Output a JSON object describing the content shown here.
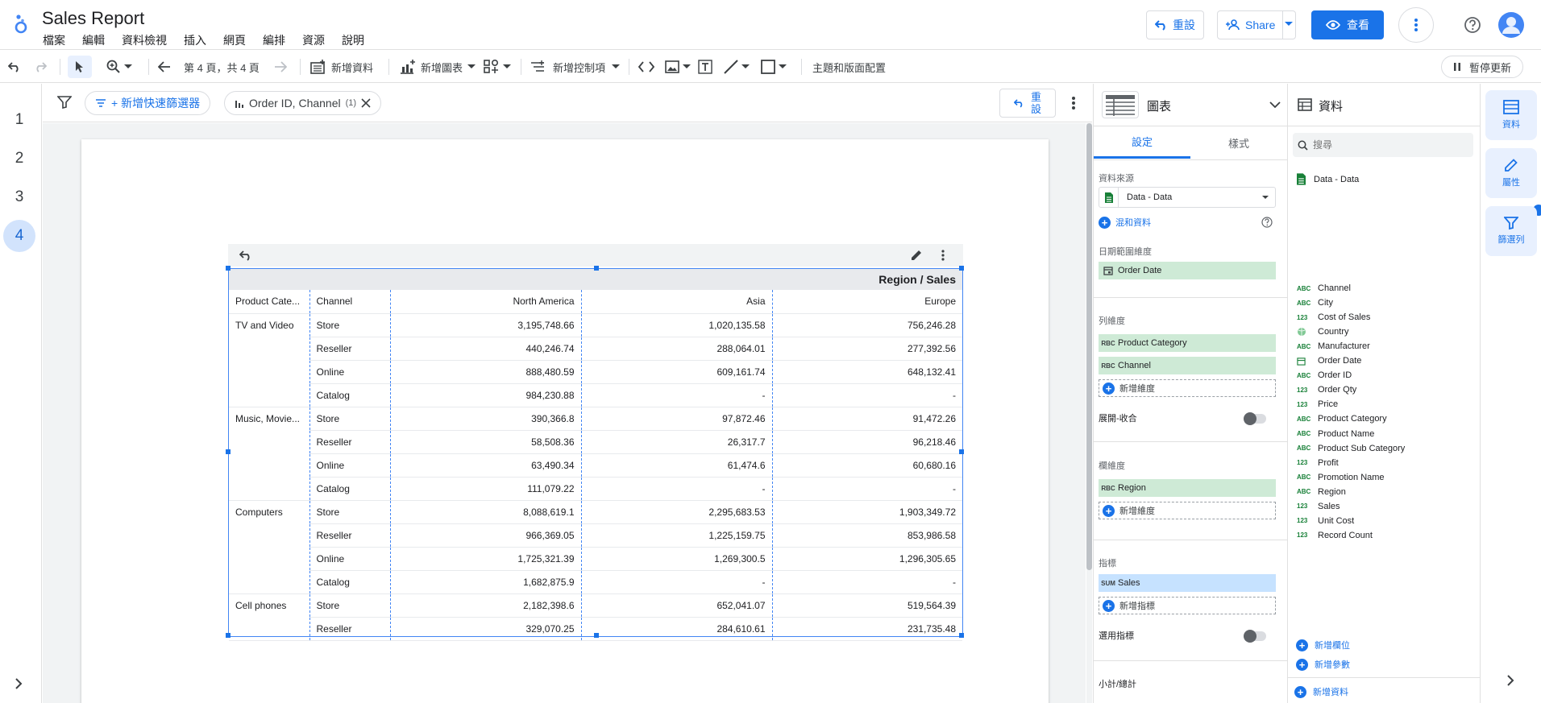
{
  "app": {
    "title": "Sales Report",
    "menu": [
      "檔案",
      "編輯",
      "資料檢視",
      "插入",
      "網頁",
      "編排",
      "資源",
      "說明"
    ],
    "reset_label": "重設",
    "share_label": "Share",
    "view_label": "查看"
  },
  "toolbar": {
    "page_indicator": "第 4 頁，共 4 頁",
    "add_data": "新增資料",
    "add_chart": "新增圖表",
    "add_control": "新增控制項",
    "theme_layout": "主題和版面配置",
    "pause_update": "暫停更新"
  },
  "pages": [
    "1",
    "2",
    "3",
    "4"
  ],
  "active_page": "4",
  "filterbar": {
    "add_quick_filter": "+ 新增快速篩選器",
    "chip_label": "Order ID, Channel",
    "chip_count": "(1)",
    "reset_label": "重設"
  },
  "table": {
    "header_title": "Region / Sales",
    "columns": [
      "Product Cate...",
      "Channel",
      "North America",
      "Asia",
      "Europe"
    ],
    "rows": [
      {
        "cat": "TV and Video",
        "channel": "Store",
        "na": "3,195,748.66",
        "asia": "1,020,135.58",
        "eu": "756,246.28"
      },
      {
        "cat": "",
        "channel": "Reseller",
        "na": "440,246.74",
        "asia": "288,064.01",
        "eu": "277,392.56"
      },
      {
        "cat": "",
        "channel": "Online",
        "na": "888,480.59",
        "asia": "609,161.74",
        "eu": "648,132.41"
      },
      {
        "cat": "",
        "channel": "Catalog",
        "na": "984,230.88",
        "asia": "-",
        "eu": "-"
      },
      {
        "cat": "Music, Movie...",
        "channel": "Store",
        "na": "390,366.8",
        "asia": "97,872.46",
        "eu": "91,472.26"
      },
      {
        "cat": "",
        "channel": "Reseller",
        "na": "58,508.36",
        "asia": "26,317.7",
        "eu": "96,218.46"
      },
      {
        "cat": "",
        "channel": "Online",
        "na": "63,490.34",
        "asia": "61,474.6",
        "eu": "60,680.16"
      },
      {
        "cat": "",
        "channel": "Catalog",
        "na": "111,079.22",
        "asia": "-",
        "eu": "-"
      },
      {
        "cat": "Computers",
        "channel": "Store",
        "na": "8,088,619.1",
        "asia": "2,295,683.53",
        "eu": "1,903,349.72"
      },
      {
        "cat": "",
        "channel": "Reseller",
        "na": "966,369.05",
        "asia": "1,225,159.75",
        "eu": "853,986.58"
      },
      {
        "cat": "",
        "channel": "Online",
        "na": "1,725,321.39",
        "asia": "1,269,300.5",
        "eu": "1,296,305.65"
      },
      {
        "cat": "",
        "channel": "Catalog",
        "na": "1,682,875.9",
        "asia": "-",
        "eu": "-"
      },
      {
        "cat": "Cell phones",
        "channel": "Store",
        "na": "2,182,398.6",
        "asia": "652,041.07",
        "eu": "519,564.39"
      },
      {
        "cat": "",
        "channel": "Reseller",
        "na": "329,070.25",
        "asia": "284,610.61",
        "eu": "231,735.48"
      }
    ]
  },
  "props": {
    "title": "圖表",
    "tab_setup": "設定",
    "tab_style": "樣式",
    "data_source_label": "資料來源",
    "data_source_value": "Data - Data",
    "blend_label": "混和資料",
    "date_range_label": "日期範圍維度",
    "date_field": "Order Date",
    "row_dim_label": "列維度",
    "row_dims": [
      "Product Category",
      "Channel"
    ],
    "add_dimension": "新增維度",
    "expand_collapse": "展開-收合",
    "col_dim_label": "欄維度",
    "col_dims": [
      "Region"
    ],
    "metric_label": "指標",
    "metric_agg": "SUM",
    "metric_field": "Sales",
    "add_metric": "新增指標",
    "optional_metrics": "選用指標",
    "subtotal_label": "小計/總計"
  },
  "data_panel": {
    "title": "資料",
    "search_placeholder": "搜尋",
    "source": "Data - Data",
    "fields": [
      {
        "type": "ABC",
        "name": "Channel"
      },
      {
        "type": "ABC",
        "name": "City"
      },
      {
        "type": "123",
        "name": "Cost of Sales"
      },
      {
        "type": "geo",
        "name": "Country"
      },
      {
        "type": "ABC",
        "name": "Manufacturer"
      },
      {
        "type": "date",
        "name": "Order Date"
      },
      {
        "type": "ABC",
        "name": "Order ID"
      },
      {
        "type": "123",
        "name": "Order Qty"
      },
      {
        "type": "123",
        "name": "Price"
      },
      {
        "type": "ABC",
        "name": "Product Category"
      },
      {
        "type": "ABC",
        "name": "Product Name"
      },
      {
        "type": "ABC",
        "name": "Product Sub Category"
      },
      {
        "type": "123",
        "name": "Profit"
      },
      {
        "type": "ABC",
        "name": "Promotion Name"
      },
      {
        "type": "ABC",
        "name": "Region"
      },
      {
        "type": "123",
        "name": "Sales"
      },
      {
        "type": "123",
        "name": "Unit Cost"
      },
      {
        "type": "123",
        "name": "Record Count"
      }
    ],
    "add_field": "新增欄位",
    "add_param": "新增參數",
    "add_data": "新增資料"
  },
  "right_rail": {
    "data": "資料",
    "properties": "屬性",
    "filter": "篩選列"
  },
  "colors": {
    "accent": "#1a73e8",
    "dimension": "#ceead6",
    "metric": "#c6e2ff"
  }
}
